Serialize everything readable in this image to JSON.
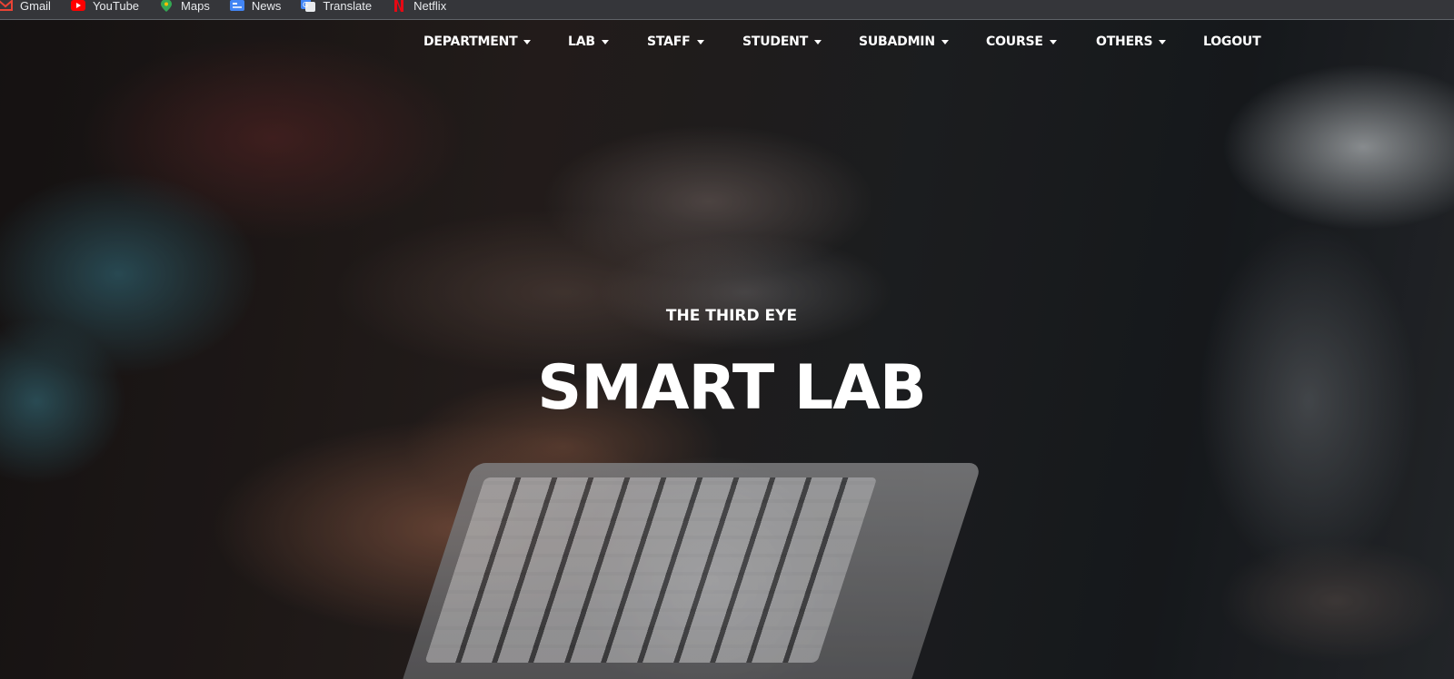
{
  "bookmarks": [
    {
      "label": "Gmail",
      "icon": "gmail-icon",
      "color": "#ea4335"
    },
    {
      "label": "YouTube",
      "icon": "youtube-icon",
      "color": "#ff0000"
    },
    {
      "label": "Maps",
      "icon": "maps-icon",
      "color": "#34a853"
    },
    {
      "label": "News",
      "icon": "news-icon",
      "color": "#4285f4"
    },
    {
      "label": "Translate",
      "icon": "translate-icon",
      "color": "#4285f4"
    },
    {
      "label": "Netflix",
      "icon": "netflix-icon",
      "color": "#e50914"
    }
  ],
  "nav": {
    "items": [
      {
        "label": "DEPARTMENT",
        "dropdown": true
      },
      {
        "label": "LAB",
        "dropdown": true
      },
      {
        "label": "STAFF",
        "dropdown": true
      },
      {
        "label": "STUDENT",
        "dropdown": true
      },
      {
        "label": "SUBADMIN",
        "dropdown": true
      },
      {
        "label": "COURSE",
        "dropdown": true
      },
      {
        "label": "OTHERS",
        "dropdown": true
      },
      {
        "label": "LOGOUT",
        "dropdown": false
      }
    ]
  },
  "hero": {
    "kicker": "THE THIRD EYE",
    "title": "SMART LAB",
    "text_color": "#ffffff"
  }
}
